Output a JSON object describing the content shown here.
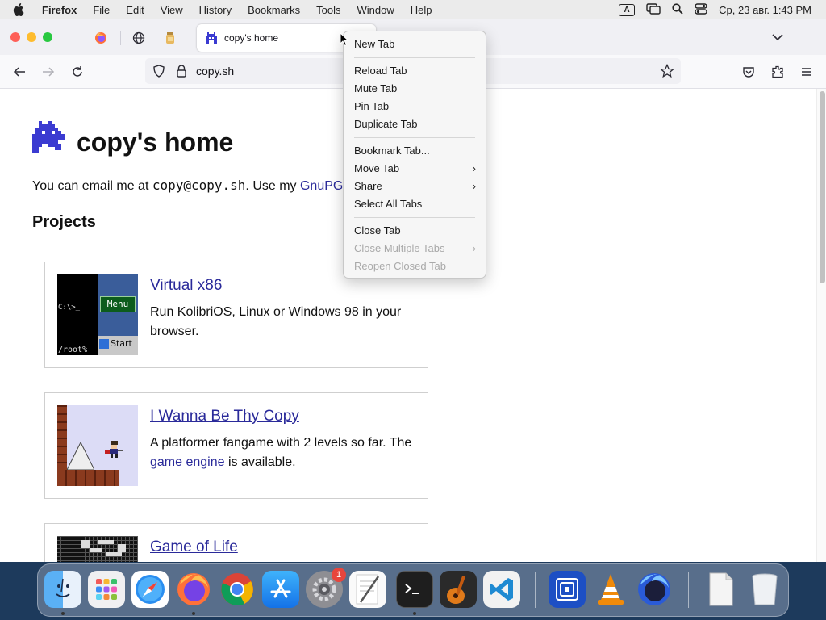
{
  "menubar": {
    "app_name": "Firefox",
    "items": [
      "File",
      "Edit",
      "View",
      "History",
      "Bookmarks",
      "Tools",
      "Window",
      "Help"
    ],
    "input_source": "A",
    "clock": "Ср, 23 авг.  1:43 PM"
  },
  "browser": {
    "active_tab_title": "copy's home",
    "url": "copy.sh"
  },
  "page": {
    "title": "copy's home",
    "intro_prefix": "You can email me at ",
    "intro_email": "copy@copy.sh",
    "intro_middle": ". Use my ",
    "intro_link": "GnuPG",
    "projects_heading": "Projects",
    "projects": [
      {
        "title": "Virtual x86",
        "description": "Run KolibriOS, Linux or Windows 98 in your browser.",
        "thumb_text": {
          "prompt": "C:\\>_",
          "menu": "Menu",
          "root": "/root%",
          "start": "Start"
        }
      },
      {
        "title": "I Wanna Be Thy Copy",
        "description_prefix": "A platformer fangame with 2 levels so far. The ",
        "description_link": "game engine",
        "description_suffix": " is available."
      },
      {
        "title": "Game of Life"
      }
    ]
  },
  "context_menu": {
    "items": [
      {
        "label": "New Tab",
        "enabled": true
      },
      {
        "label": "Reload Tab",
        "enabled": true
      },
      {
        "label": "Mute Tab",
        "enabled": true
      },
      {
        "label": "Pin Tab",
        "enabled": true
      },
      {
        "label": "Duplicate Tab",
        "enabled": true
      },
      {
        "label": "Bookmark Tab...",
        "enabled": true
      },
      {
        "label": "Move Tab",
        "enabled": true,
        "submenu": true
      },
      {
        "label": "Share",
        "enabled": true,
        "submenu": true
      },
      {
        "label": "Select All Tabs",
        "enabled": true
      },
      {
        "label": "Close Tab",
        "enabled": true
      },
      {
        "label": "Close Multiple Tabs",
        "enabled": false,
        "submenu": true
      },
      {
        "label": "Reopen Closed Tab",
        "enabled": false
      }
    ]
  },
  "dock": {
    "apps": [
      "finder-icon",
      "launchpad-icon",
      "safari-icon",
      "firefox-icon",
      "chrome-icon",
      "app-store-icon",
      "system-settings-icon",
      "textedit-icon",
      "terminal-icon",
      "garageband-icon",
      "vscode-icon",
      "ftp-app-icon",
      "vlc-icon",
      "firefox-dev-icon",
      "downloads-stack-icon",
      "trash-icon"
    ],
    "settings_badge": "1"
  },
  "colors": {
    "link": "#2a2a9a",
    "menubar_bg": "#ebebeb",
    "tabstrip_bg": "#f0f0f4"
  }
}
